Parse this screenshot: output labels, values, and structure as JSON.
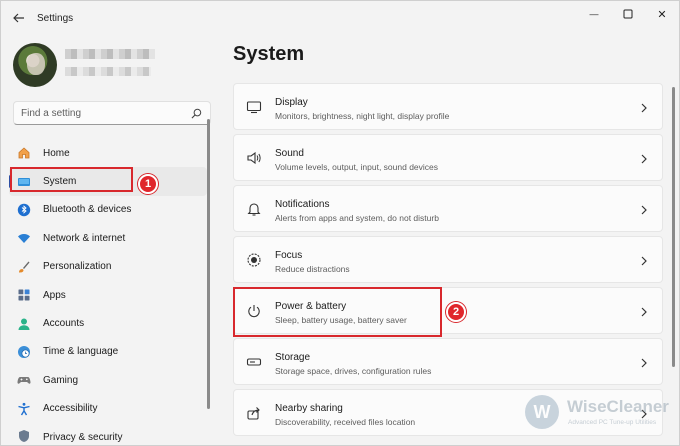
{
  "window": {
    "title": "Settings",
    "minimize_glyph": "—",
    "close_glyph": "✕"
  },
  "search": {
    "placeholder": "Find a setting"
  },
  "page_title": "System",
  "sidebar": {
    "items": [
      {
        "label": "Home",
        "icon": "home-icon",
        "selected": false
      },
      {
        "label": "System",
        "icon": "monitor-icon",
        "selected": true
      },
      {
        "label": "Bluetooth & devices",
        "icon": "bluetooth-icon",
        "selected": false
      },
      {
        "label": "Network & internet",
        "icon": "wifi-icon",
        "selected": false
      },
      {
        "label": "Personalization",
        "icon": "brush-icon",
        "selected": false
      },
      {
        "label": "Apps",
        "icon": "apps-icon",
        "selected": false
      },
      {
        "label": "Accounts",
        "icon": "account-icon",
        "selected": false
      },
      {
        "label": "Time & language",
        "icon": "clock-globe-icon",
        "selected": false
      },
      {
        "label": "Gaming",
        "icon": "gamepad-icon",
        "selected": false
      },
      {
        "label": "Accessibility",
        "icon": "accessibility-icon",
        "selected": false
      },
      {
        "label": "Privacy & security",
        "icon": "shield-icon",
        "selected": false
      }
    ]
  },
  "settings": [
    {
      "title": "Display",
      "desc": "Monitors, brightness, night light, display profile",
      "icon": "display-icon"
    },
    {
      "title": "Sound",
      "desc": "Volume levels, output, input, sound devices",
      "icon": "speaker-icon"
    },
    {
      "title": "Notifications",
      "desc": "Alerts from apps and system, do not disturb",
      "icon": "bell-icon"
    },
    {
      "title": "Focus",
      "desc": "Reduce distractions",
      "icon": "focus-icon"
    },
    {
      "title": "Power & battery",
      "desc": "Sleep, battery usage, battery saver",
      "icon": "power-icon"
    },
    {
      "title": "Storage",
      "desc": "Storage space, drives, configuration rules",
      "icon": "storage-icon"
    },
    {
      "title": "Nearby sharing",
      "desc": "Discoverability, received files location",
      "icon": "share-icon"
    }
  ],
  "annotations": {
    "badge_1": "1",
    "badge_2": "2"
  },
  "watermark": {
    "logo_letter": "W",
    "name": "WiseCleaner",
    "tagline": "Advanced PC Tune-up Utilities"
  },
  "colors": {
    "accent": "#2e4fa3",
    "highlight": "#d8282d"
  }
}
